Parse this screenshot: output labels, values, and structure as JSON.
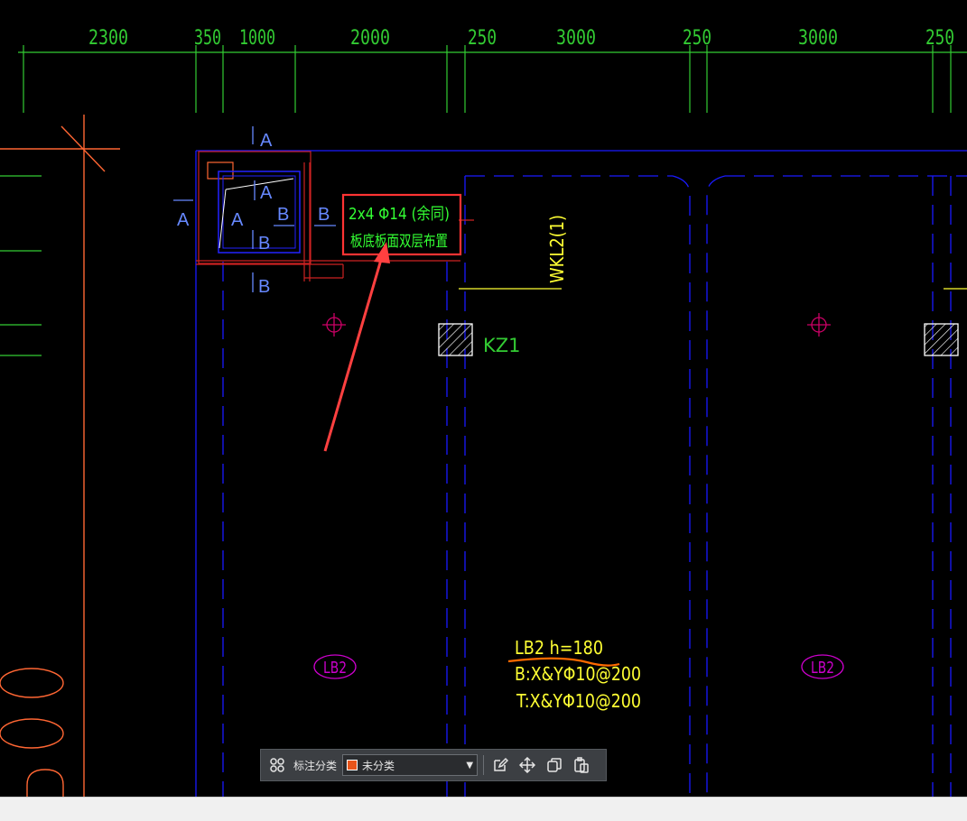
{
  "dimensions": {
    "labels": [
      "2300",
      "350",
      "1000",
      "2000",
      "250",
      "3000",
      "250",
      "3000",
      "250"
    ],
    "color": "#33cc33"
  },
  "section_marks": {
    "a": "A",
    "b": "B"
  },
  "rebar_note": {
    "line1": "2x4 Φ14 (余同)",
    "line2": "板底板面双层布置",
    "color": "#33ff33",
    "box_color": "#ff3333"
  },
  "beam_label": "WKL2(1)",
  "column_label": "KZ1",
  "slab": {
    "tag": "LB2",
    "tag_color": "#cc00cc",
    "title": "LB2  h=180",
    "bottom_rebar": "B:X&YΦ10@200",
    "top_rebar": "T:X&YΦ10@200",
    "text_color": "#ffff33"
  },
  "annotation_arrow_color": "#ff4040",
  "toolbar": {
    "category_label": "标注分类",
    "category_value": "未分类",
    "icons": [
      "grid-icon",
      "edit-icon",
      "move-icon",
      "copy-icon",
      "paste-icon"
    ]
  },
  "colors": {
    "background": "#000000",
    "axis": "#0000ff",
    "grid": "#ff6633",
    "dim_line": "#33cc33"
  }
}
